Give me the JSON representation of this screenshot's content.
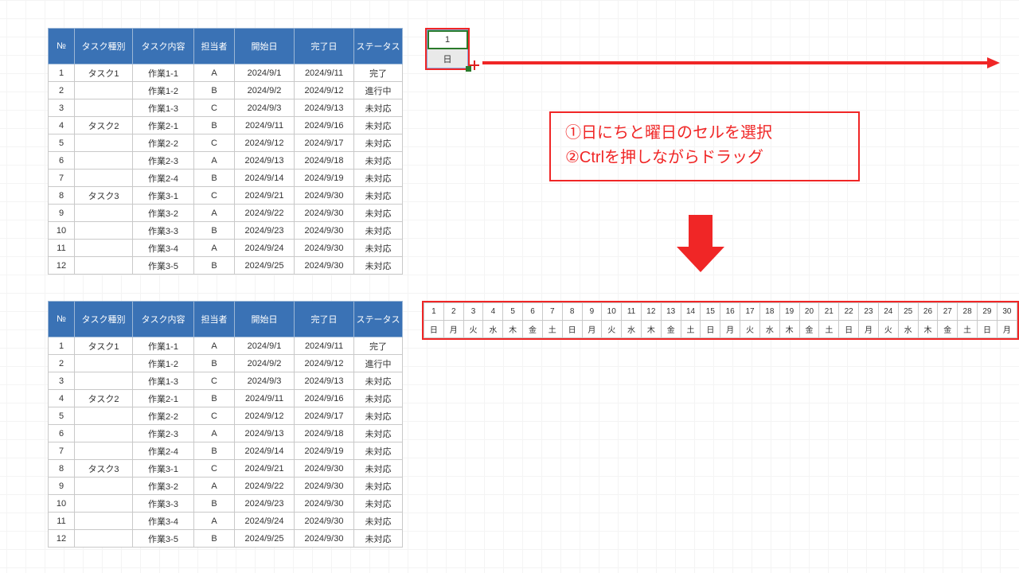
{
  "table_headers": {
    "no": "№",
    "kind": "タスク種別",
    "task": "タスク内容",
    "pic": "担当者",
    "start": "開始日",
    "end": "完了日",
    "status": "ステータス"
  },
  "rows": [
    {
      "no": "1",
      "kind": "タスク1",
      "task": "作業1-1",
      "pic": "A",
      "start": "2024/9/1",
      "end": "2024/9/11",
      "status": "完了"
    },
    {
      "no": "2",
      "kind": "",
      "task": "作業1-2",
      "pic": "B",
      "start": "2024/9/2",
      "end": "2024/9/12",
      "status": "進行中"
    },
    {
      "no": "3",
      "kind": "",
      "task": "作業1-3",
      "pic": "C",
      "start": "2024/9/3",
      "end": "2024/9/13",
      "status": "未対応"
    },
    {
      "no": "4",
      "kind": "タスク2",
      "task": "作業2-1",
      "pic": "B",
      "start": "2024/9/11",
      "end": "2024/9/16",
      "status": "未対応"
    },
    {
      "no": "5",
      "kind": "",
      "task": "作業2-2",
      "pic": "C",
      "start": "2024/9/12",
      "end": "2024/9/17",
      "status": "未対応"
    },
    {
      "no": "6",
      "kind": "",
      "task": "作業2-3",
      "pic": "A",
      "start": "2024/9/13",
      "end": "2024/9/18",
      "status": "未対応"
    },
    {
      "no": "7",
      "kind": "",
      "task": "作業2-4",
      "pic": "B",
      "start": "2024/9/14",
      "end": "2024/9/19",
      "status": "未対応"
    },
    {
      "no": "8",
      "kind": "タスク3",
      "task": "作業3-1",
      "pic": "C",
      "start": "2024/9/21",
      "end": "2024/9/30",
      "status": "未対応"
    },
    {
      "no": "9",
      "kind": "",
      "task": "作業3-2",
      "pic": "A",
      "start": "2024/9/22",
      "end": "2024/9/30",
      "status": "未対応"
    },
    {
      "no": "10",
      "kind": "",
      "task": "作業3-3",
      "pic": "B",
      "start": "2024/9/23",
      "end": "2024/9/30",
      "status": "未対応"
    },
    {
      "no": "11",
      "kind": "",
      "task": "作業3-4",
      "pic": "A",
      "start": "2024/9/24",
      "end": "2024/9/30",
      "status": "未対応"
    },
    {
      "no": "12",
      "kind": "",
      "task": "作業3-5",
      "pic": "B",
      "start": "2024/9/25",
      "end": "2024/9/30",
      "status": "未対応"
    }
  ],
  "fill_cells": {
    "top": "1",
    "bottom": "日"
  },
  "instructions": {
    "line1": "①日にちと曜日のセルを選択",
    "line2": "②Ctrlを押しながらドラッグ"
  },
  "calendar": {
    "days": [
      "1",
      "2",
      "3",
      "4",
      "5",
      "6",
      "7",
      "8",
      "9",
      "10",
      "11",
      "12",
      "13",
      "14",
      "15",
      "16",
      "17",
      "18",
      "19",
      "20",
      "21",
      "22",
      "23",
      "24",
      "25",
      "26",
      "27",
      "28",
      "29",
      "30"
    ],
    "wdays": [
      "日",
      "月",
      "火",
      "水",
      "木",
      "金",
      "土",
      "日",
      "月",
      "火",
      "水",
      "木",
      "金",
      "土",
      "日",
      "月",
      "火",
      "水",
      "木",
      "金",
      "土",
      "日",
      "月",
      "火",
      "水",
      "木",
      "金",
      "土",
      "日",
      "月"
    ]
  }
}
